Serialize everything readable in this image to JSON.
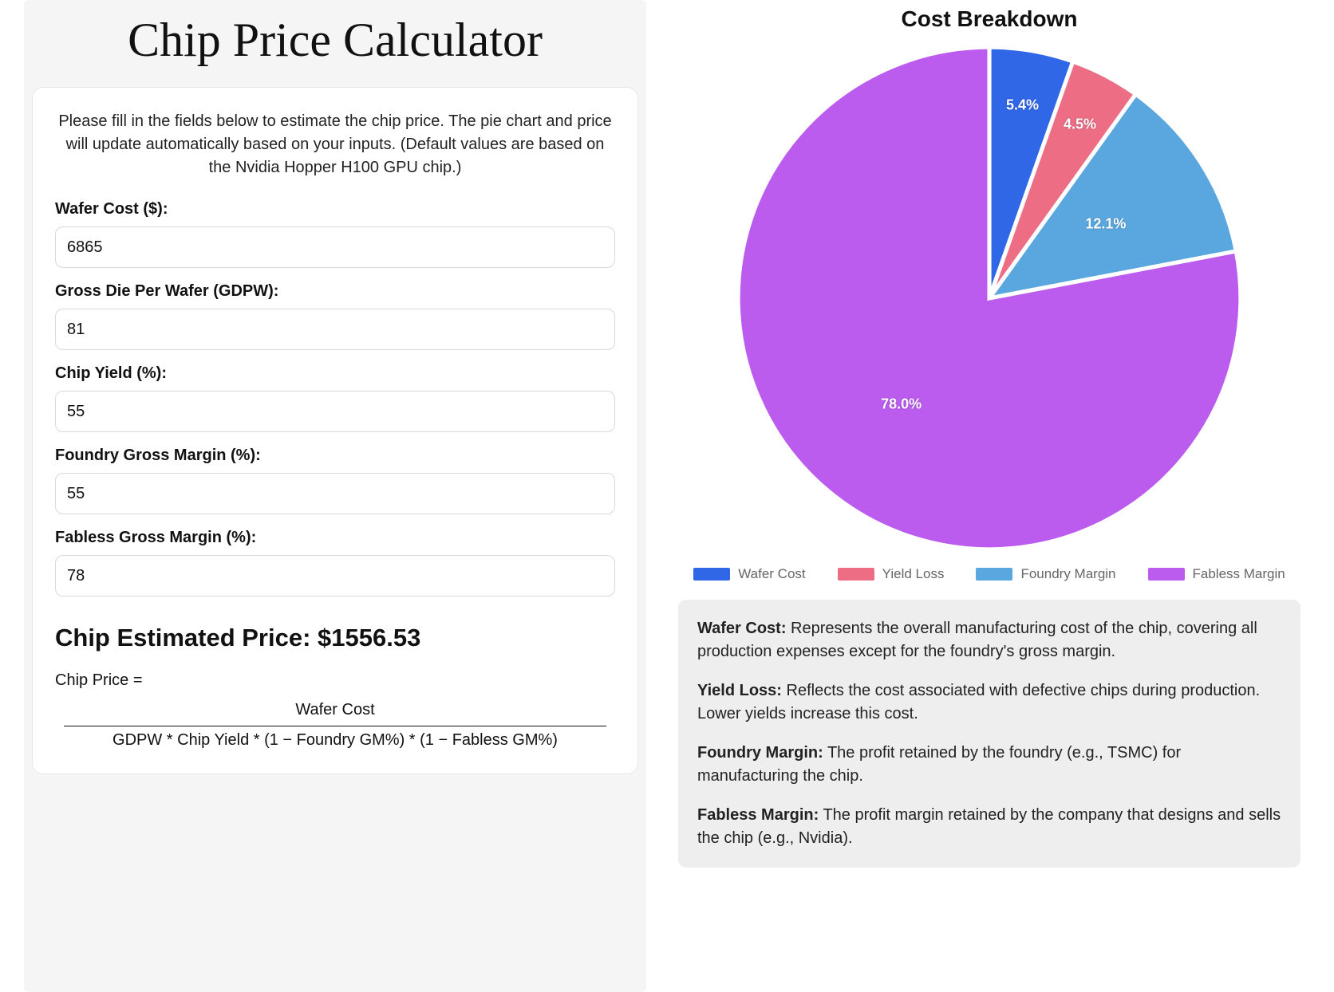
{
  "header": {
    "title": "Chip Price Calculator"
  },
  "intro": "Please fill in the fields below to estimate the chip price. The pie chart and price will update automatically based on your inputs. (Default values are based on the Nvidia Hopper H100 GPU chip.)",
  "fields": {
    "wafer_cost": {
      "label": "Wafer Cost ($):",
      "value": "6865"
    },
    "gdpw": {
      "label": "Gross Die Per Wafer (GDPW):",
      "value": "81"
    },
    "yield": {
      "label": "Chip Yield (%):",
      "value": "55"
    },
    "foundry_margin": {
      "label": "Foundry Gross Margin (%):",
      "value": "55"
    },
    "fabless_margin": {
      "label": "Fabless Gross Margin (%):",
      "value": "78"
    }
  },
  "estimate": {
    "label": "Chip Estimated Price: ",
    "value": "$1556.53"
  },
  "formula": {
    "lead": "Chip Price =",
    "numerator": "Wafer Cost",
    "denominator": "GDPW * Chip Yield * (1 − Foundry GM%) * (1 − Fabless GM%)"
  },
  "chart_data": {
    "type": "pie",
    "title": "Cost Breakdown",
    "series": [
      {
        "name": "Wafer Cost",
        "value": 5.4,
        "color": "#2f67e6"
      },
      {
        "name": "Yield Loss",
        "value": 4.5,
        "color": "#ed6d85"
      },
      {
        "name": "Foundry Margin",
        "value": 12.1,
        "color": "#5aa7df"
      },
      {
        "name": "Fabless Margin",
        "value": 78.0,
        "color": "#bb5cef"
      }
    ],
    "legend_position": "bottom"
  },
  "glossary": [
    {
      "term": "Wafer Cost:",
      "desc": " Represents the overall manufacturing cost of the chip, covering all production expenses except for the foundry's gross margin."
    },
    {
      "term": "Yield Loss:",
      "desc": " Reflects the cost associated with defective chips during production. Lower yields increase this cost."
    },
    {
      "term": "Foundry Margin:",
      "desc": " The profit retained by the foundry (e.g., TSMC) for manufacturing the chip."
    },
    {
      "term": "Fabless Margin:",
      "desc": " The profit margin retained by the company that designs and sells the chip (e.g., Nvidia)."
    }
  ]
}
